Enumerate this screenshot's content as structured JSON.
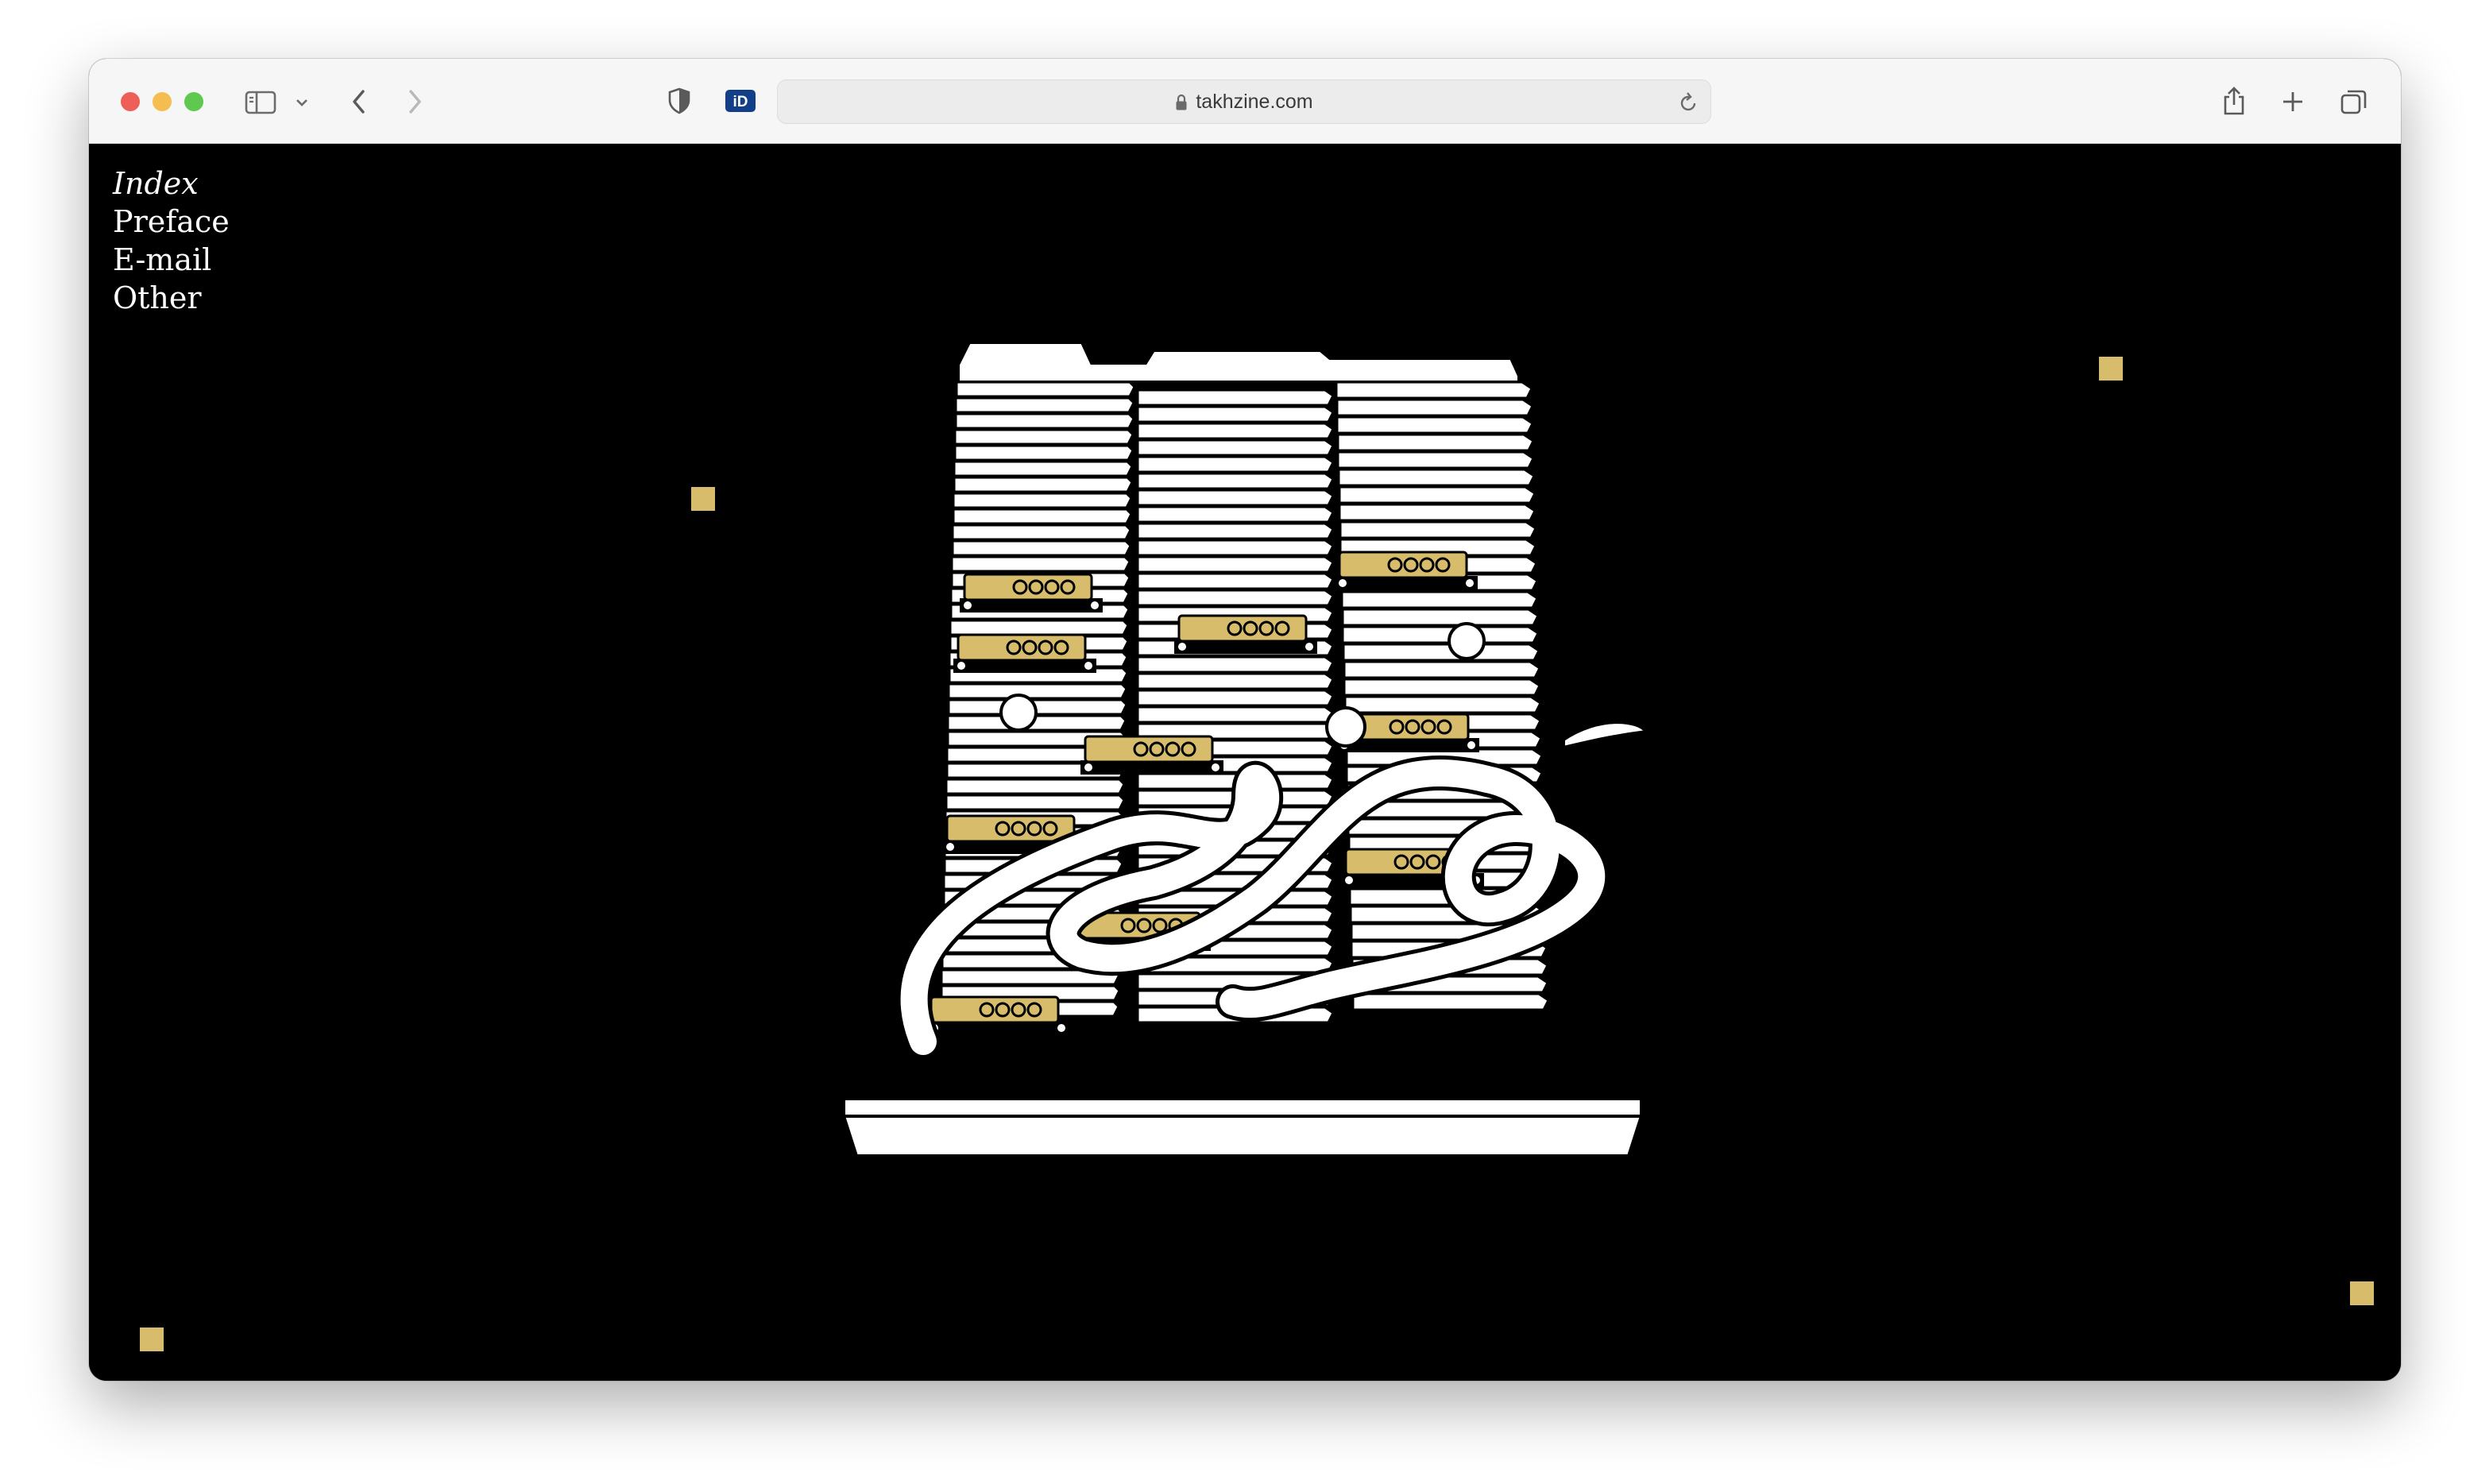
{
  "browser": {
    "url": "takhzine.com"
  },
  "site": {
    "nav": [
      "Index",
      "Preface",
      "E-mail",
      "Other"
    ],
    "active_nav": "Index"
  },
  "colors": {
    "background": "#000000",
    "accent_gold": "#d6bc6b",
    "text": "#ffffff"
  },
  "icons": {
    "sidebar": "sidebar-icon",
    "back": "chevron-left-icon",
    "forward": "chevron-right-icon",
    "privacy": "shield-icon",
    "extension": "id-badge-icon",
    "lock": "lock-icon",
    "reload": "reload-icon",
    "share": "share-icon",
    "new_tab": "plus-icon",
    "tabs": "tab-overview-icon"
  }
}
